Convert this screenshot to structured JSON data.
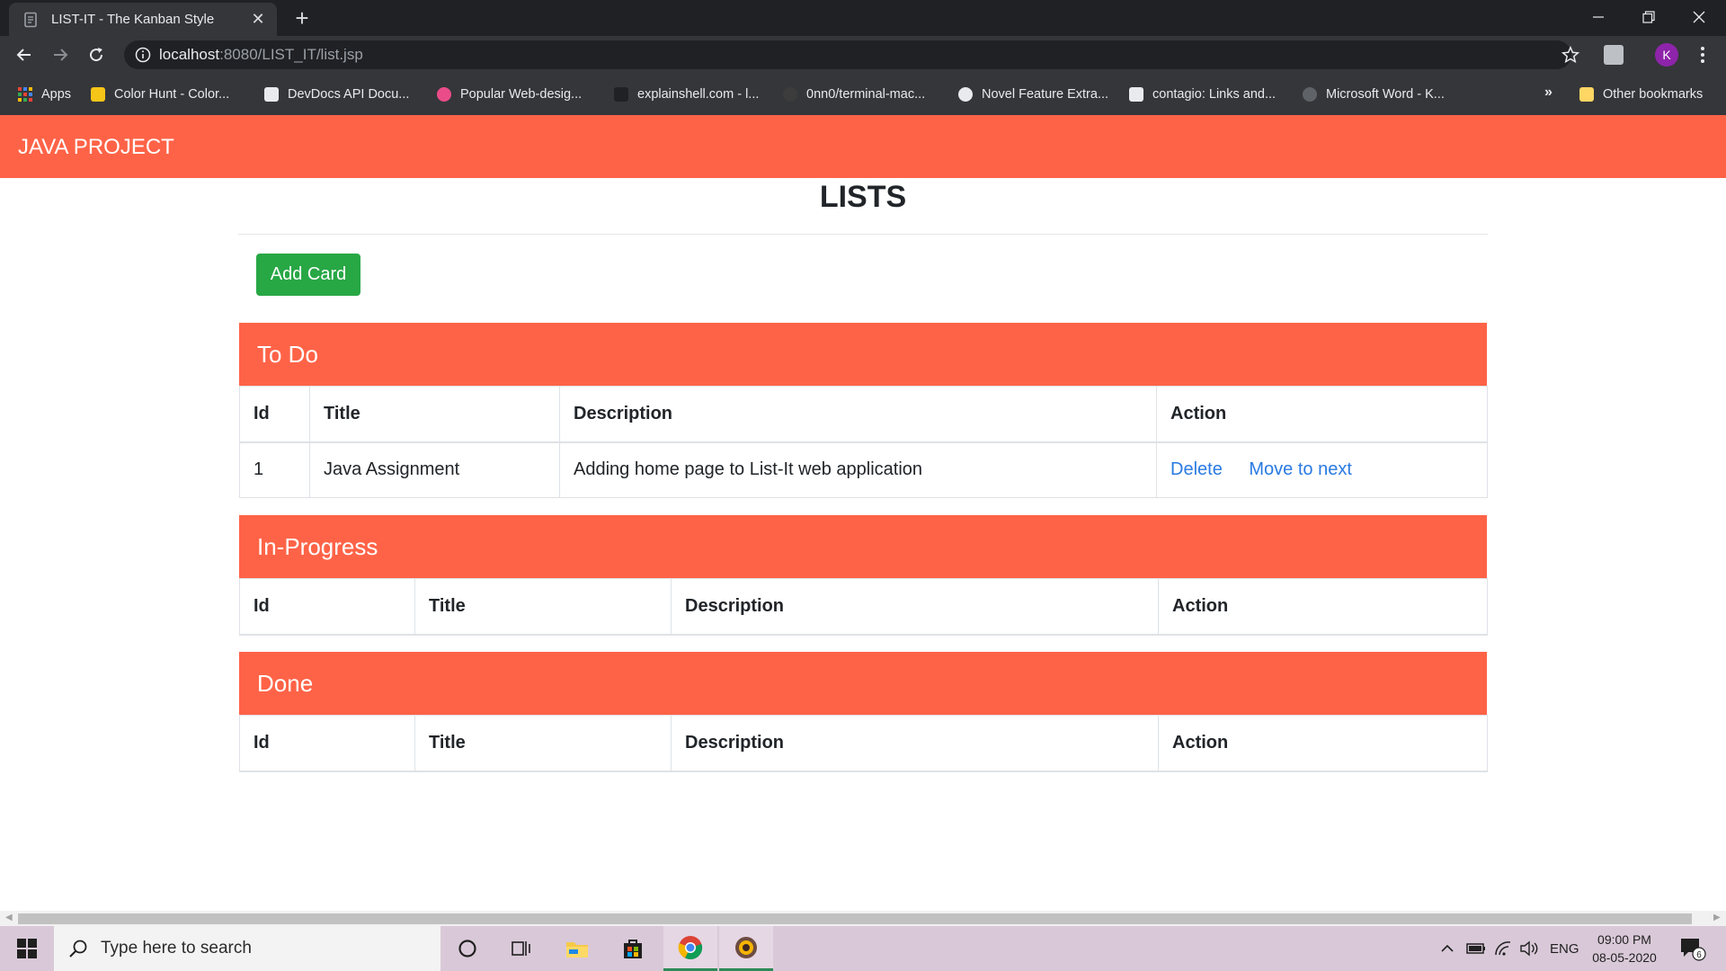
{
  "browser": {
    "tab_title": "LIST-IT - The Kanban Style",
    "tab_close": "✕",
    "new_tab": "+",
    "url_host": "localhost",
    "url_rest": ":8080/LIST_IT/list.jsp",
    "avatar_letter": "K",
    "bookmarks": [
      {
        "label": "Apps"
      },
      {
        "label": "Color Hunt - Color..."
      },
      {
        "label": "DevDocs API Docu..."
      },
      {
        "label": "Popular Web-desig..."
      },
      {
        "label": "explainshell.com - l..."
      },
      {
        "label": "0nn0/terminal-mac..."
      },
      {
        "label": "Novel Feature Extra..."
      },
      {
        "label": "contagio: Links and..."
      },
      {
        "label": "Microsoft Word - K..."
      }
    ],
    "bookmarks_more": "»",
    "other_bookmarks": "Other bookmarks"
  },
  "navbar": {
    "brand": "JAVA PROJECT"
  },
  "page": {
    "title": "LISTS",
    "add_card_label": "Add Card",
    "columns": {
      "id": "Id",
      "title": "Title",
      "description": "Description",
      "action": "Action"
    },
    "lists": [
      {
        "name": "To Do",
        "rows": [
          {
            "id": "1",
            "title": "Java Assignment",
            "description": "Adding home page to List-It web application",
            "delete_label": "Delete",
            "move_label": "Move to next"
          }
        ]
      },
      {
        "name": "In-Progress",
        "rows": []
      },
      {
        "name": "Done",
        "rows": []
      }
    ]
  },
  "taskbar": {
    "search_placeholder": "Type here to search",
    "language": "ENG",
    "time": "09:00 PM",
    "date": "08-05-2020",
    "notification_count": "6"
  },
  "colors": {
    "accent": "#ff6347",
    "add_button": "#28a745",
    "link": "#2a7ae2"
  }
}
